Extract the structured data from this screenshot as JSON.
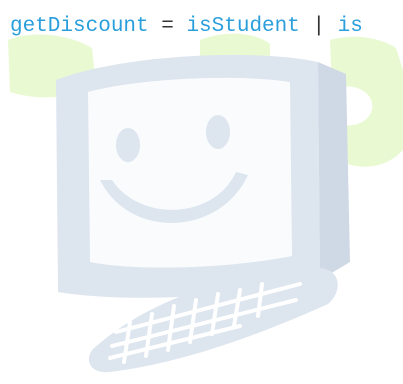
{
  "code": {
    "tokens": [
      {
        "text": "getDiscount",
        "kind": "ident"
      },
      {
        "text": " = ",
        "kind": "op"
      },
      {
        "text": "isStudent",
        "kind": "ident"
      },
      {
        "text": " | ",
        "kind": "op"
      },
      {
        "text": "is",
        "kind": "ident"
      }
    ]
  },
  "illustration": {
    "name": "smiling-computer-with-cup",
    "monitor_color": "#dde5ef",
    "face_color": "#ffffff",
    "accent_color": "#e9fad3"
  }
}
